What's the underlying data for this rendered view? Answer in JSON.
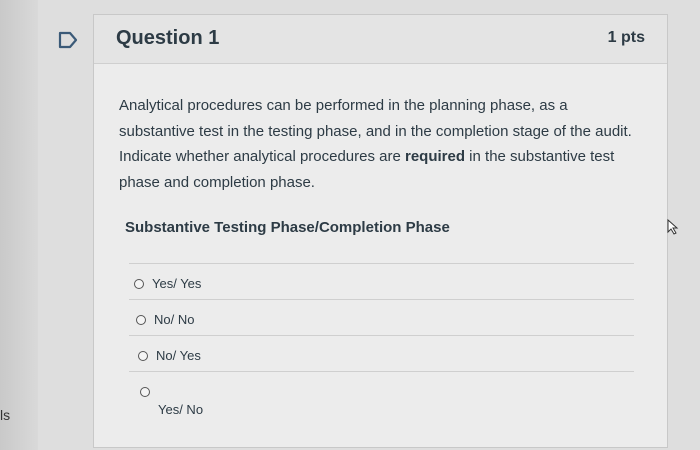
{
  "sidebar": {
    "partial_text": "ls"
  },
  "question": {
    "title": "Question 1",
    "points": "1 pts",
    "text_part1": "Analytical procedures can be performed in the planning phase, as a substantive test in the testing phase, and in the completion stage of the audit. Indicate whether analytical procedures are ",
    "text_bold": "required",
    "text_part2": " in the substantive test phase and completion phase.",
    "subheading": "Substantive Testing Phase/Completion Phase"
  },
  "answers": [
    {
      "label": "Yes/ Yes"
    },
    {
      "label": "No/ No"
    },
    {
      "label": "No/ Yes"
    },
    {
      "label": "Yes/ No"
    }
  ],
  "colors": {
    "text": "#2d3b45",
    "background": "#ececec"
  }
}
